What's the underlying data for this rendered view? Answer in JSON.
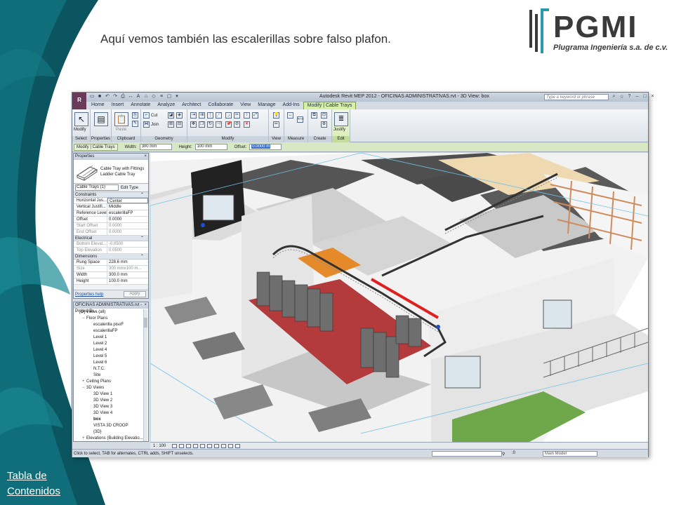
{
  "slide": {
    "title": "Aquí vemos también las escalerillas sobre falso plafon.",
    "toc_line1": "Tabla de",
    "toc_line2": "Contenidos",
    "colors": {
      "teal_dark": "#0b4f5a",
      "teal": "#127f8c",
      "text": "#333333"
    }
  },
  "logo": {
    "wordmark": "PGMI",
    "subtitle": "Plugrama Ingeniería s.a. de c.v."
  },
  "app": {
    "logo_letter": "R",
    "window_title": "Autodesk Revit MEP 2012 -    OFICINAS ADMINISTRATIVAS.rvt - 3D View: box",
    "search_placeholder": "Type a keyword or phrase",
    "tabs": [
      {
        "label": "Home"
      },
      {
        "label": "Insert"
      },
      {
        "label": "Annotate"
      },
      {
        "label": "Analyze"
      },
      {
        "label": "Architect"
      },
      {
        "label": "Collaborate"
      },
      {
        "label": "View"
      },
      {
        "label": "Manage"
      },
      {
        "label": "Add-Ins"
      },
      {
        "label": "Modify | Cable Trays",
        "active": true
      }
    ],
    "ribbon_groups": {
      "select": "Select",
      "properties": "Properties",
      "clipboard": "Clipboard",
      "geometry": "Geometry",
      "modify": "Modify",
      "view": "View",
      "measure": "Measure",
      "create": "Create",
      "edit": "Edit"
    },
    "ribbon_buttons": {
      "modify": "Modify",
      "paste": "Paste",
      "cut": "Cut",
      "join": "Join",
      "justify": "Justify"
    },
    "options_bar": {
      "context": "Modify | Cable Trays",
      "width_label": "Width:",
      "width_value": "300 mm",
      "height_label": "Height:",
      "height_value": "100 mm",
      "offset_label": "Offset:",
      "offset_value": "0.0000 m"
    },
    "properties": {
      "header": "Properties",
      "type_line1": "Cable Tray with Fittings",
      "type_line2": "Ladder Cable Tray",
      "instance_selector": "Cable Trays (1)",
      "edit_type": "Edit Type",
      "sections": [
        {
          "name": "Constraints",
          "rows": [
            {
              "k": "Horizontal Jus...",
              "v": "Center",
              "boxed": true
            },
            {
              "k": "Vertical Justifi...",
              "v": "Middle"
            },
            {
              "k": "Reference Level",
              "v": "escalerillaFP"
            },
            {
              "k": "Offset",
              "v": "0.0000"
            },
            {
              "k": "Start Offset",
              "v": "0.0000",
              "dim": true
            },
            {
              "k": "End Offset",
              "v": "0.0000",
              "dim": true
            }
          ]
        },
        {
          "name": "Electrical",
          "rows": [
            {
              "k": "Bottom Elevat...",
              "v": "-0.0500",
              "dim": true
            },
            {
              "k": "Top Elevation",
              "v": "0.0500",
              "dim": true
            }
          ]
        },
        {
          "name": "Dimensions",
          "rows": [
            {
              "k": "Rung Space",
              "v": "228.6 mm"
            },
            {
              "k": "Size",
              "v": "300 mmx100 m...",
              "dim": true
            },
            {
              "k": "Width",
              "v": "300.0 mm"
            },
            {
              "k": "Height",
              "v": "100.0 mm"
            }
          ]
        }
      ],
      "help_link": "Properties help",
      "apply_label": "Apply"
    },
    "project_browser": {
      "header": "OFICINAS ADMINISTRATIVAS.rvt - Project Br...",
      "items": [
        {
          "label": "[O] Views (all)",
          "level": 0,
          "exp": "−"
        },
        {
          "label": "Floor Plans",
          "level": 1,
          "exp": "−"
        },
        {
          "label": "escalerilla pisoF",
          "level": 2
        },
        {
          "label": "escalerillaFP",
          "level": 2
        },
        {
          "label": "Level 1",
          "level": 2
        },
        {
          "label": "Level 2",
          "level": 2
        },
        {
          "label": "Level 4",
          "level": 2
        },
        {
          "label": "Level 5",
          "level": 2
        },
        {
          "label": "Level 6",
          "level": 2
        },
        {
          "label": "N.T.C.",
          "level": 2
        },
        {
          "label": "Site",
          "level": 2
        },
        {
          "label": "Ceiling Plans",
          "level": 1,
          "exp": "+"
        },
        {
          "label": "3D Views",
          "level": 1,
          "exp": "−"
        },
        {
          "label": "3D View 1",
          "level": 2
        },
        {
          "label": "3D View 2",
          "level": 2
        },
        {
          "label": "3D View 3",
          "level": 2
        },
        {
          "label": "3D View 4",
          "level": 2
        },
        {
          "label": "box",
          "level": 2,
          "bold": true
        },
        {
          "label": "VISTA 3D CROOP",
          "level": 2
        },
        {
          "label": "{3D}",
          "level": 2
        },
        {
          "label": "Elevations (Building Elevatio...",
          "level": 1,
          "exp": "+"
        }
      ]
    },
    "view_scale": "1 : 100",
    "status_text": "Click to select, TAB for alternates, CTRL adds, SHIFT unselects.",
    "status_zero": ":0",
    "model_selector": "Main Model"
  }
}
